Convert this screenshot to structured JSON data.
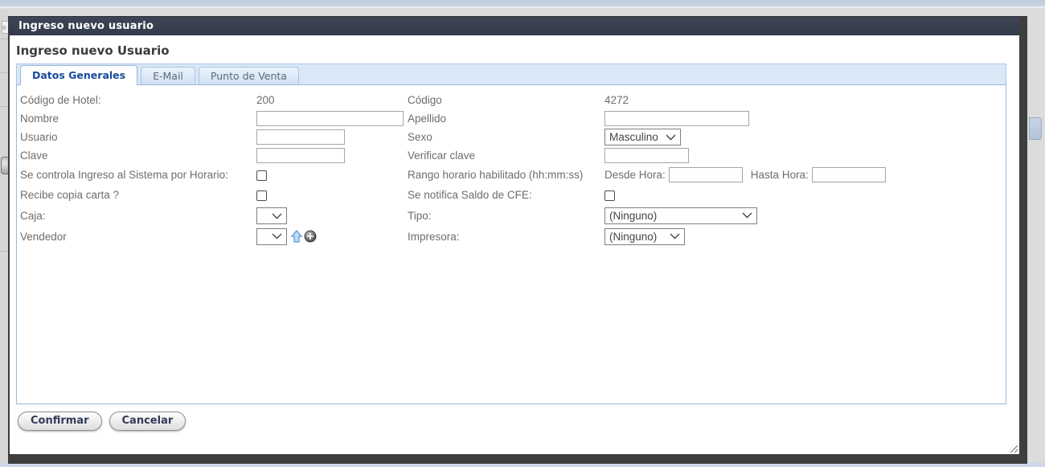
{
  "window": {
    "title": "Ingreso nuevo usuario"
  },
  "dialog": {
    "heading": "Ingreso nuevo Usuario",
    "tabs": [
      {
        "label": "Datos Generales",
        "active": true
      },
      {
        "label": "E-Mail",
        "active": false
      },
      {
        "label": "Punto de Venta",
        "active": false
      }
    ],
    "form": {
      "codigo_hotel": {
        "label": "Código de Hotel:",
        "value": "200"
      },
      "codigo": {
        "label": "Código",
        "value": "4272"
      },
      "nombre": {
        "label": "Nombre",
        "value": ""
      },
      "apellido": {
        "label": "Apellido",
        "value": ""
      },
      "usuario": {
        "label": "Usuario",
        "value": ""
      },
      "sexo": {
        "label": "Sexo",
        "value": "Masculino"
      },
      "clave": {
        "label": "Clave",
        "value": ""
      },
      "verificar_clave": {
        "label": "Verificar clave",
        "value": ""
      },
      "control_horario": {
        "label": "Se controla Ingreso al Sistema por Horario:",
        "checked": false
      },
      "rango_horario": {
        "label": "Rango horario habilitado (hh:mm:ss)",
        "desde_label": "Desde Hora:",
        "desde_value": "",
        "hasta_label": "Hasta Hora:",
        "hasta_value": ""
      },
      "recibe_copia": {
        "label": "Recibe copia carta ?",
        "checked": false
      },
      "notifica_saldo": {
        "label": "Se notifica Saldo de CFE:",
        "checked": false
      },
      "caja": {
        "label": "Caja:",
        "value": ""
      },
      "tipo": {
        "label": "Tipo:",
        "value": "(Ninguno)"
      },
      "vendedor": {
        "label": "Vendedor",
        "value": ""
      },
      "impresora": {
        "label": "Impresora:",
        "value": "(Ninguno)"
      }
    },
    "buttons": {
      "confirm": "Confirmar",
      "cancel": "Cancelar"
    },
    "icons": {
      "vendedor_up": "up-arrow",
      "vendedor_add": "plus-circle",
      "select_chevron": "chevron-down",
      "resize": "resize-handle"
    }
  },
  "colors": {
    "titlebar": "#383f4e",
    "modal_shadow": "#3e3e3e",
    "active_tab_text": "#17499c",
    "tabstrip_bg": "#d9e7f7",
    "panel_border": "#9cb8da",
    "label_text": "#6d6d6d",
    "button_text": "#343a5a",
    "page_top_strip": "#c3cfde",
    "page_bottom_strip": "#ccd9e7"
  }
}
